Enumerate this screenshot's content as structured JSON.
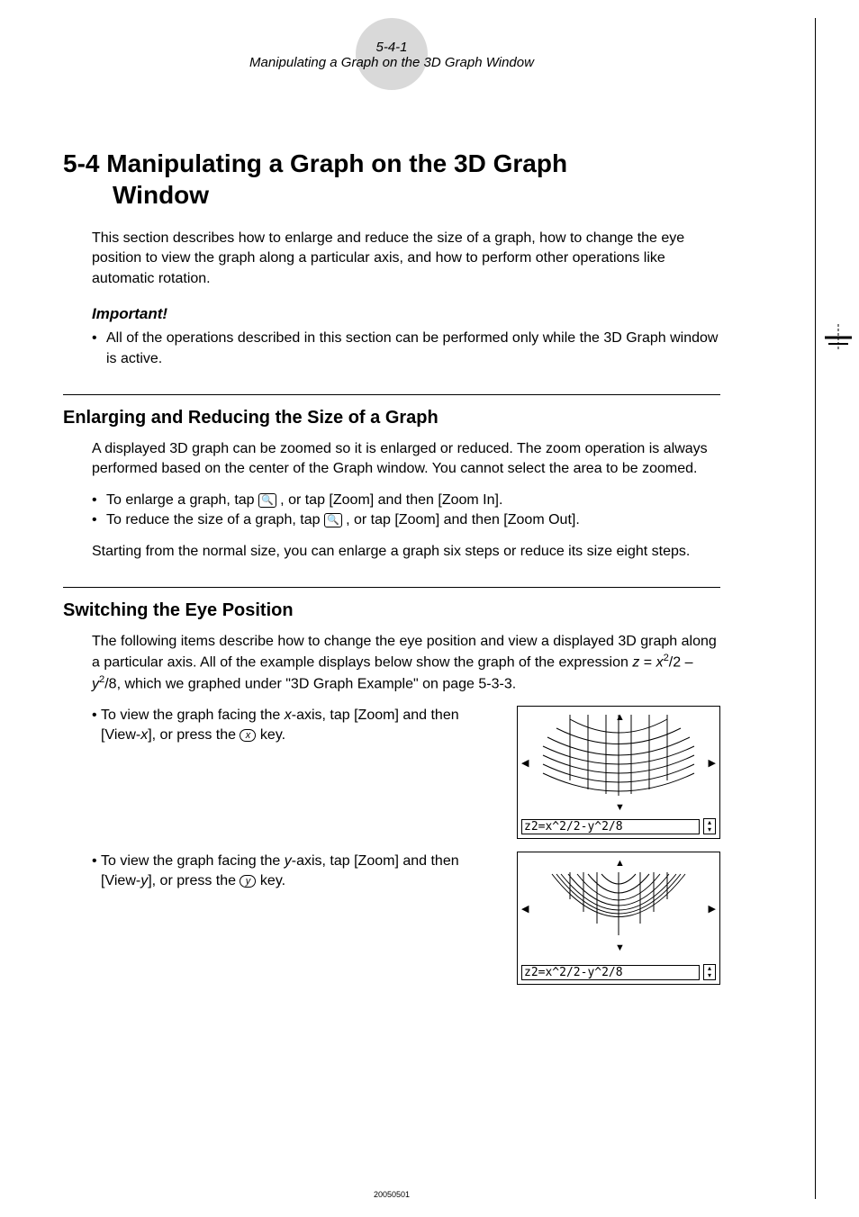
{
  "header": {
    "page_num": "5-4-1",
    "title": "Manipulating a Graph on the 3D Graph Window"
  },
  "h1_prefix": "5-4 ",
  "h1_line1": "Manipulating a Graph on the 3D Graph",
  "h1_line2": "Window",
  "intro": "This section describes how to enlarge and reduce the size of a graph, how to change the eye position to view the graph along a particular axis, and how to perform other operations like automatic rotation.",
  "important_label": "Important!",
  "important_bullet": "All of the operations described in this section can be performed only while the 3D Graph window is active.",
  "section1": {
    "heading": "Enlarging and Reducing the Size of a Graph",
    "para1": "A displayed 3D graph can be zoomed so it is enlarged or reduced. The zoom operation is always performed based on the center of the Graph window. You cannot select the area to be zoomed.",
    "bullet1_a": "To enlarge a graph, tap ",
    "bullet1_b": ", or tap [Zoom] and then [Zoom In].",
    "bullet2_a": "To reduce the size of a graph, tap ",
    "bullet2_b": ", or tap [Zoom] and then [Zoom Out].",
    "para2": "Starting from the normal size, you can enlarge a graph six steps or reduce its size eight steps."
  },
  "section2": {
    "heading": "Switching the Eye Position",
    "para1_a": "The following items describe how to change the eye position and view a displayed 3D graph along a particular axis. All of the example displays below show the graph of the expression ",
    "para1_eq": "z = x²/2 – y²/8",
    "para1_b": ", which we graphed under \"3D Graph Example\" on page 5-3-3.",
    "bullet1_a": "To view the graph facing the ",
    "bullet1_axis": "x",
    "bullet1_b": "-axis, tap [Zoom] and then [View-",
    "bullet1_c": "], or press the ",
    "bullet1_key": "x",
    "bullet1_d": " key.",
    "bullet2_a": "To view the graph facing the ",
    "bullet2_axis": "y",
    "bullet2_b": "-axis, tap [Zoom] and then [View-",
    "bullet2_c": "], or press the ",
    "bullet2_key": "y",
    "bullet2_d": " key."
  },
  "screenshot_formula": "z2=x^2/2-y^2/8",
  "footer_date": "20050501",
  "icons": {
    "zoom_in": "🔍+",
    "zoom_out": "🔍-"
  }
}
